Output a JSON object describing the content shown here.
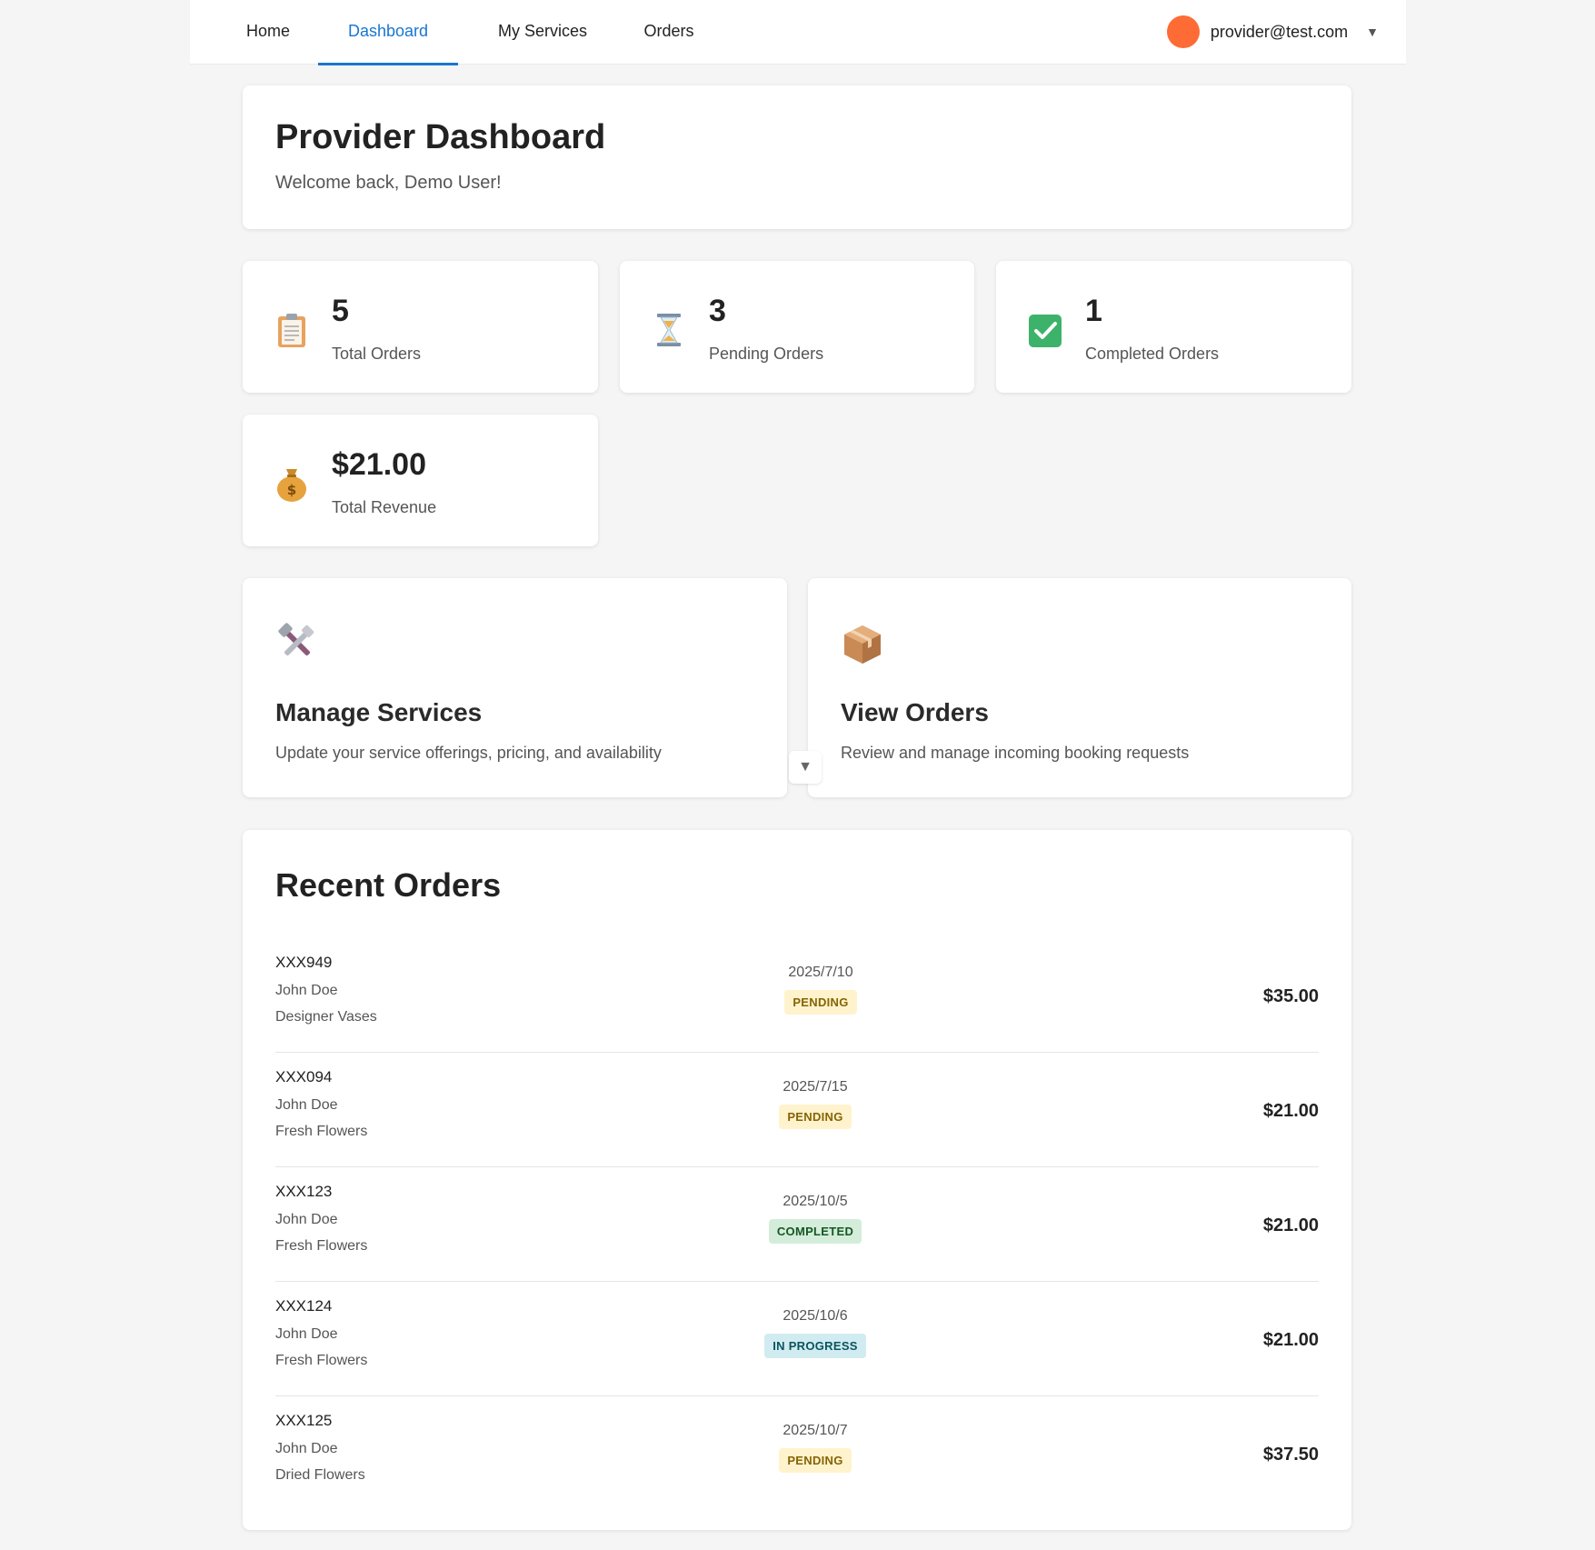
{
  "nav": {
    "items": [
      {
        "label": "Home"
      },
      {
        "label": "Dashboard"
      },
      {
        "label": "My Services"
      },
      {
        "label": "Orders"
      }
    ],
    "active": "Dashboard",
    "user_email": "provider@test.com",
    "avatar_color": "#ff6b35",
    "caret": "▼"
  },
  "header": {
    "title": "Provider Dashboard",
    "subtitle": "Welcome back, Demo User!"
  },
  "stats": [
    {
      "icon": "clipboard-icon",
      "value": "5",
      "label": "Total Orders"
    },
    {
      "icon": "hourglass-icon",
      "value": "3",
      "label": "Pending Orders"
    },
    {
      "icon": "check-icon",
      "value": "1",
      "label": "Completed Orders"
    },
    {
      "icon": "money-bag-icon",
      "value": "$21.00",
      "label": "Total Revenue"
    }
  ],
  "actions": [
    {
      "icon": "tools-icon",
      "title": "Manage Services",
      "desc": "Update your service offerings, pricing, and availability"
    },
    {
      "icon": "package-icon",
      "title": "View Orders",
      "desc": "Review and manage incoming booking requests"
    }
  ],
  "recent_orders": {
    "title": "Recent Orders",
    "rows": [
      {
        "id": "XXX949",
        "customer": "John Doe",
        "service": "Designer Vases",
        "date": "2025/7/10",
        "status": "PENDING",
        "amount": "$35.00"
      },
      {
        "id": "XXX094",
        "customer": "John Doe",
        "service": "Fresh Flowers",
        "date": "2025/7/15",
        "status": "PENDING",
        "amount": "$21.00"
      },
      {
        "id": "XXX123",
        "customer": "John Doe",
        "service": "Fresh Flowers",
        "date": "2025/10/5",
        "status": "COMPLETED",
        "amount": "$21.00"
      },
      {
        "id": "XXX124",
        "customer": "John Doe",
        "service": "Fresh Flowers",
        "date": "2025/10/6",
        "status": "IN PROGRESS",
        "amount": "$21.00"
      },
      {
        "id": "XXX125",
        "customer": "John Doe",
        "service": "Dried Flowers",
        "date": "2025/10/7",
        "status": "PENDING",
        "amount": "$37.50"
      }
    ]
  },
  "status_colors": {
    "pending_bg": "#fff3cd",
    "completed_bg": "#d4edda",
    "in_progress_bg": "#d1ecf1",
    "accent": "#1976d2"
  }
}
